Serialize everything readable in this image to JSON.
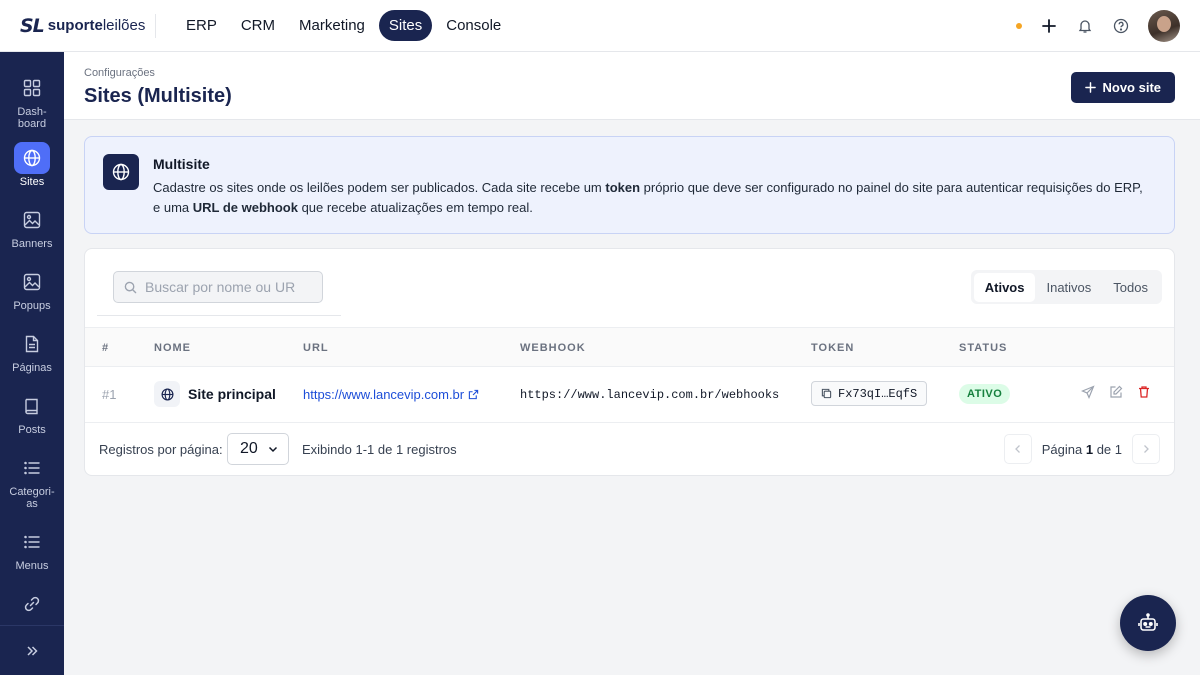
{
  "brand": {
    "mark": "SL",
    "name_bold": "suporte",
    "name_light": "leilões"
  },
  "nav": {
    "items": [
      {
        "label": "ERP",
        "active": false
      },
      {
        "label": "CRM",
        "active": false
      },
      {
        "label": "Marketing",
        "active": false
      },
      {
        "label": "Sites",
        "active": true
      },
      {
        "label": "Console",
        "active": false
      }
    ]
  },
  "sidebar": {
    "items": [
      {
        "label": "Dash-board",
        "icon": "dashboard-icon"
      },
      {
        "label": "Sites",
        "icon": "globe-icon",
        "active": true
      },
      {
        "label": "Banners",
        "icon": "image-icon"
      },
      {
        "label": "Popups",
        "icon": "image-icon"
      },
      {
        "label": "Páginas",
        "icon": "document-icon"
      },
      {
        "label": "Posts",
        "icon": "book-icon"
      },
      {
        "label": "Categori-as",
        "icon": "list-icon"
      },
      {
        "label": "Menus",
        "icon": "list-icon"
      },
      {
        "label": "",
        "icon": "link-icon"
      }
    ]
  },
  "header": {
    "breadcrumb": "Configurações",
    "title": "Sites (Multisite)",
    "new_button": "Novo site"
  },
  "info": {
    "title": "Multisite",
    "text_1": "Cadastre os sites onde os leilões podem ser publicados. Cada site recebe um ",
    "bold_1": "token",
    "text_2": " próprio que deve ser configurado no painel do site para autenticar requisições do ERP, e uma ",
    "bold_2": "URL de webhook",
    "text_3": " que recebe atualizações em tempo real."
  },
  "search": {
    "placeholder": "Buscar por nome ou URL",
    "value": ""
  },
  "tabs": [
    {
      "label": "Ativos",
      "active": true
    },
    {
      "label": "Inativos",
      "active": false
    },
    {
      "label": "Todos",
      "active": false
    }
  ],
  "table": {
    "columns": [
      "#",
      "NOME",
      "URL",
      "WEBHOOK",
      "TOKEN",
      "STATUS"
    ],
    "rows": [
      {
        "num": "#1",
        "name": "Site principal",
        "url": "https://www.lancevip.com.br",
        "webhook": "https://www.lancevip.com.br/webhooks",
        "token": "Fx73qI…EqfS",
        "status": "ATIVO"
      }
    ]
  },
  "footer": {
    "per_page_label": "Registros por página:",
    "per_page_value": "20",
    "showing": "Exibindo 1-1 de 1 registros",
    "page_word": "Página",
    "page_current": "1",
    "page_of": "de 1"
  },
  "colors": {
    "primary": "#1a2550",
    "accent": "#4f6ef7",
    "status_ok": "#15803d",
    "danger": "#dc2626",
    "notify_dot": "#f5a524"
  }
}
